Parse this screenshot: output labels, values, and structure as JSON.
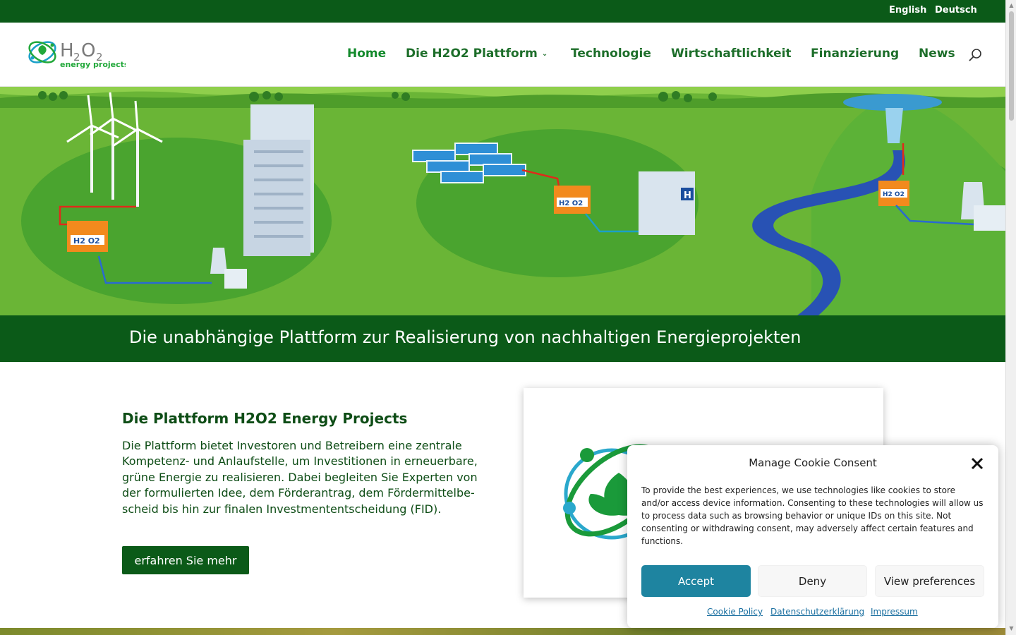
{
  "topbar": {
    "languages": [
      "English",
      "Deutsch"
    ]
  },
  "header": {
    "logo_text": "H2O2",
    "logo_subtext": "energy projects",
    "nav": [
      {
        "label": "Home",
        "active": true
      },
      {
        "label": "Die H2O2 Plattform",
        "has_dropdown": true
      },
      {
        "label": "Technologie"
      },
      {
        "label": "Wirtschaftlichkeit"
      },
      {
        "label": "Finanzierung"
      },
      {
        "label": "News"
      }
    ],
    "search_icon": "search-icon"
  },
  "hero": {
    "building_labels": [
      "H2 O2",
      "H2 O2",
      "H2 O2",
      "H"
    ]
  },
  "banner": {
    "text": "Die unabhängige Plattform zur Realisierung von nachhaltigen Energieprojekten"
  },
  "content": {
    "title": "Die Plattform H2O2 Energy Projects",
    "body": "Die Plattform bietet Investoren und Betreibern eine zentrale Kompetenz- und Anlaufstelle, um Investitionen in erneuerbare, grüne Energie zu realisieren. Dabei begleiten Sie Experten von der formulierten Idee, dem Förderantrag, dem Fördermittelbe-scheid bis hin zur finalen Investmententscheidung (FID).",
    "cta_label": "erfahren Sie mehr"
  },
  "cookie": {
    "title": "Manage Cookie Consent",
    "text": "To provide the best experiences, we use technologies like cookies to store and/or access device information. Consenting to these technologies will allow us to process data such as browsing behavior or unique IDs on this site. Not consenting or withdrawing consent, may adversely affect certain features and functions.",
    "accept": "Accept",
    "deny": "Deny",
    "preferences": "View preferences",
    "links": [
      "Cookie Policy",
      "Datenschutzerklärung",
      "Impressum"
    ]
  },
  "colors": {
    "brand_green": "#0b5a18",
    "nav_green": "#1d6e2a",
    "accept_blue": "#1e84a0",
    "link_blue": "#1a6fa0"
  }
}
